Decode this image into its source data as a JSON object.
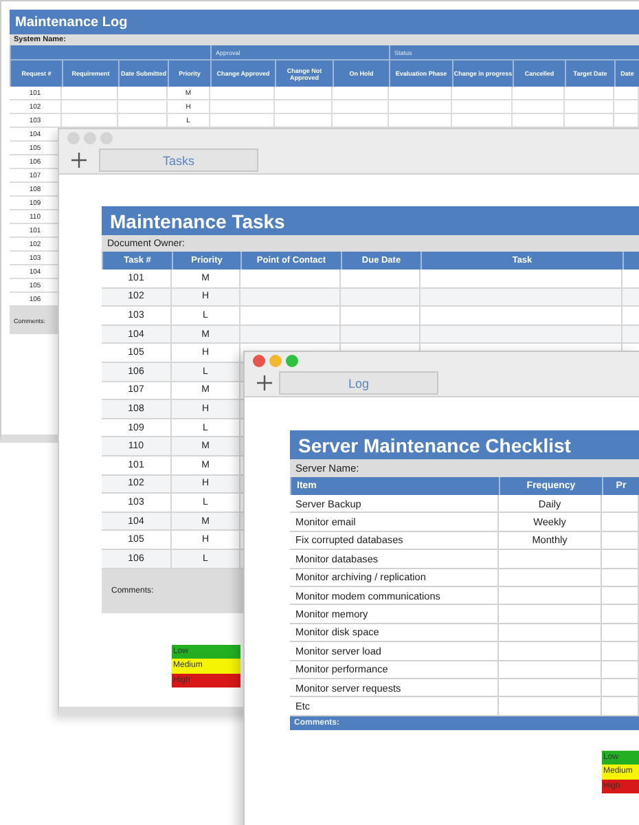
{
  "log_window": {
    "title": "Maintenance Log",
    "system_name_label": "System Name:",
    "groups": [
      "Approval",
      "Status"
    ],
    "columns": [
      "Request #",
      "Requirement",
      "Date Submitted",
      "Priority",
      "Change Approved",
      "Change Not Approved",
      "On Hold",
      "Evaluation Phase",
      "Change in progress",
      "Cancelled",
      "Target Date",
      "Date"
    ],
    "rows": [
      {
        "request": "101",
        "priority": "M"
      },
      {
        "request": "102",
        "priority": "H"
      },
      {
        "request": "103",
        "priority": "L"
      },
      {
        "request": "104"
      },
      {
        "request": "105"
      },
      {
        "request": "106"
      },
      {
        "request": "107"
      },
      {
        "request": "108"
      },
      {
        "request": "109"
      },
      {
        "request": "110"
      },
      {
        "request": "101"
      },
      {
        "request": "102"
      },
      {
        "request": "103"
      },
      {
        "request": "104"
      },
      {
        "request": "105"
      },
      {
        "request": "106"
      }
    ],
    "comments_label": "Comments:"
  },
  "tasks_window": {
    "focused": false,
    "tab": "Tasks",
    "title": "Maintenance Tasks",
    "document_owner_label": "Document Owner:",
    "columns": [
      "Task #",
      "Priority",
      "Point of Contact",
      "Due Date",
      "Task"
    ],
    "rows": [
      {
        "task": "101",
        "priority": "M"
      },
      {
        "task": "102",
        "priority": "H"
      },
      {
        "task": "103",
        "priority": "L"
      },
      {
        "task": "104",
        "priority": "M"
      },
      {
        "task": "105",
        "priority": "H"
      },
      {
        "task": "106",
        "priority": "L"
      },
      {
        "task": "107",
        "priority": "M"
      },
      {
        "task": "108",
        "priority": "H"
      },
      {
        "task": "109",
        "priority": "L"
      },
      {
        "task": "110",
        "priority": "M"
      },
      {
        "task": "101",
        "priority": "M"
      },
      {
        "task": "102",
        "priority": "H"
      },
      {
        "task": "103",
        "priority": "L"
      },
      {
        "task": "104",
        "priority": "M"
      },
      {
        "task": "105",
        "priority": "H"
      },
      {
        "task": "106",
        "priority": "L"
      }
    ],
    "comments_label": "Comments:",
    "legend": [
      {
        "label": "Low",
        "color": "#22b022"
      },
      {
        "label": "Medium",
        "color": "#f5f500"
      },
      {
        "label": "High",
        "color": "#d81818"
      }
    ]
  },
  "checklist_window": {
    "focused": true,
    "tab": "Log",
    "title": "Server Maintenance Checklist",
    "server_name_label": "Server Name:",
    "columns": [
      "Item",
      "Frequency",
      "Pr"
    ],
    "rows": [
      {
        "item": "Server Backup",
        "frequency": "Daily"
      },
      {
        "item": "Monitor email",
        "frequency": "Weekly"
      },
      {
        "item": "Fix corrupted databases",
        "frequency": "Monthly"
      },
      {
        "item": "Monitor databases"
      },
      {
        "item": "Monitor archiving / replication"
      },
      {
        "item": "Monitor modem communications"
      },
      {
        "item": "Monitor memory"
      },
      {
        "item": "Monitor disk space"
      },
      {
        "item": "Monitor server load"
      },
      {
        "item": "Monitor performance"
      },
      {
        "item": "Monitor server requests"
      },
      {
        "item": "Etc"
      }
    ],
    "comments_label": "Comments:",
    "legend": [
      {
        "label": "Low",
        "color": "#22b022"
      },
      {
        "label": "Medium",
        "color": "#f5f500"
      },
      {
        "label": "High",
        "color": "#d81818"
      }
    ]
  }
}
